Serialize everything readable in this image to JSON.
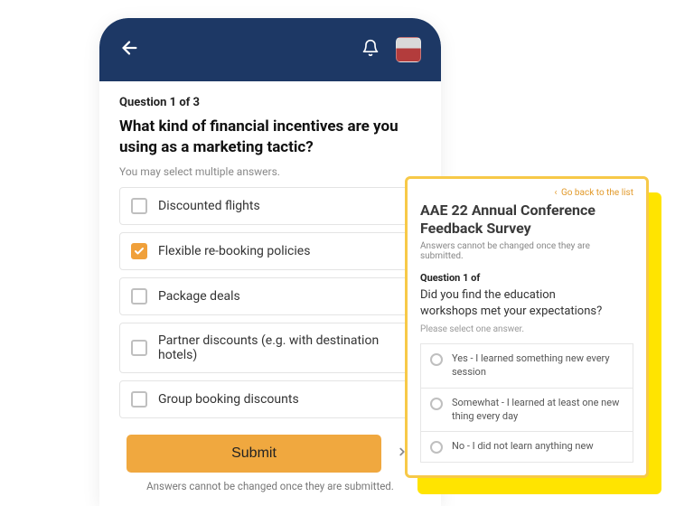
{
  "phone": {
    "question_counter": "Question 1 of 3",
    "question_title": "What kind of financial incentives are you using as a marketing tactic?",
    "select_hint": "You may select multiple answers.",
    "options": [
      {
        "label": "Discounted flights",
        "checked": false
      },
      {
        "label": "Flexible re-booking policies",
        "checked": true
      },
      {
        "label": "Package deals",
        "checked": false
      },
      {
        "label": "Partner discounts (e.g. with destination hotels)",
        "checked": false
      },
      {
        "label": "Group booking discounts",
        "checked": false
      }
    ],
    "submit_label": "Submit",
    "footnote": "Answers cannot be changed once they are submitted."
  },
  "popup": {
    "back_label": "Go back to the list",
    "title": "AAE 22 Annual Conference Feedback Survey",
    "subtitle": "Answers cannot be changed once they are submitted.",
    "question_counter": "Question 1 of",
    "question": "Did you find the education workshops met your expectations?",
    "select_hint": "Please select one answer.",
    "options": [
      {
        "label": "Yes - I learned something new every session"
      },
      {
        "label": "Somewhat - I learned at least one new thing every day"
      },
      {
        "label": "No - I did not learn anything new"
      }
    ]
  },
  "colors": {
    "header": "#1d3865",
    "accent": "#f0a83f",
    "checkbox_checked": "#f0a03a",
    "popup_border": "#f7c948",
    "popup_shadow": "#ffe400"
  }
}
